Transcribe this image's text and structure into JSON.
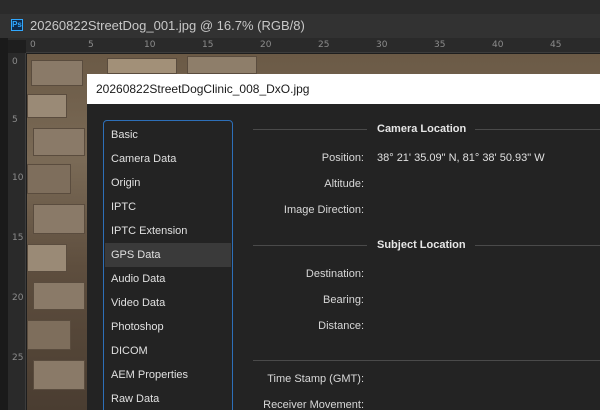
{
  "window": {
    "ps_logo": "Ps",
    "doc_tab_title": "20260822StreetDog_001.jpg @ 16.7% (RGB/8)"
  },
  "rulers": {
    "top": [
      "0",
      "5",
      "10",
      "15",
      "20",
      "25",
      "30",
      "35",
      "40",
      "45"
    ],
    "left": [
      "0",
      "5",
      "10",
      "15",
      "20",
      "25"
    ]
  },
  "dialog": {
    "title": "20260822StreetDogClinic_008_DxO.jpg",
    "categories": [
      {
        "label": "Basic"
      },
      {
        "label": "Camera Data"
      },
      {
        "label": "Origin"
      },
      {
        "label": "IPTC"
      },
      {
        "label": "IPTC Extension"
      },
      {
        "label": "GPS Data",
        "selected": true
      },
      {
        "label": "Audio Data"
      },
      {
        "label": "Video Data"
      },
      {
        "label": "Photoshop"
      },
      {
        "label": "DICOM"
      },
      {
        "label": "AEM Properties"
      },
      {
        "label": "Raw Data"
      }
    ],
    "camera_location": {
      "heading": "Camera Location",
      "position_label": "Position:",
      "position_value": "38° 21' 35.09\" N,  81° 38' 50.93\" W",
      "altitude_label": "Altitude:",
      "altitude_value": "",
      "image_direction_label": "Image Direction:",
      "image_direction_value": ""
    },
    "subject_location": {
      "heading": "Subject Location",
      "destination_label": "Destination:",
      "destination_value": "",
      "bearing_label": "Bearing:",
      "bearing_value": "",
      "distance_label": "Distance:",
      "distance_value": ""
    },
    "other": {
      "timestamp_label": "Time Stamp (GMT):",
      "timestamp_value": "",
      "receiver_movement_label": "Receiver Movement:",
      "receiver_movement_value": ""
    }
  }
}
